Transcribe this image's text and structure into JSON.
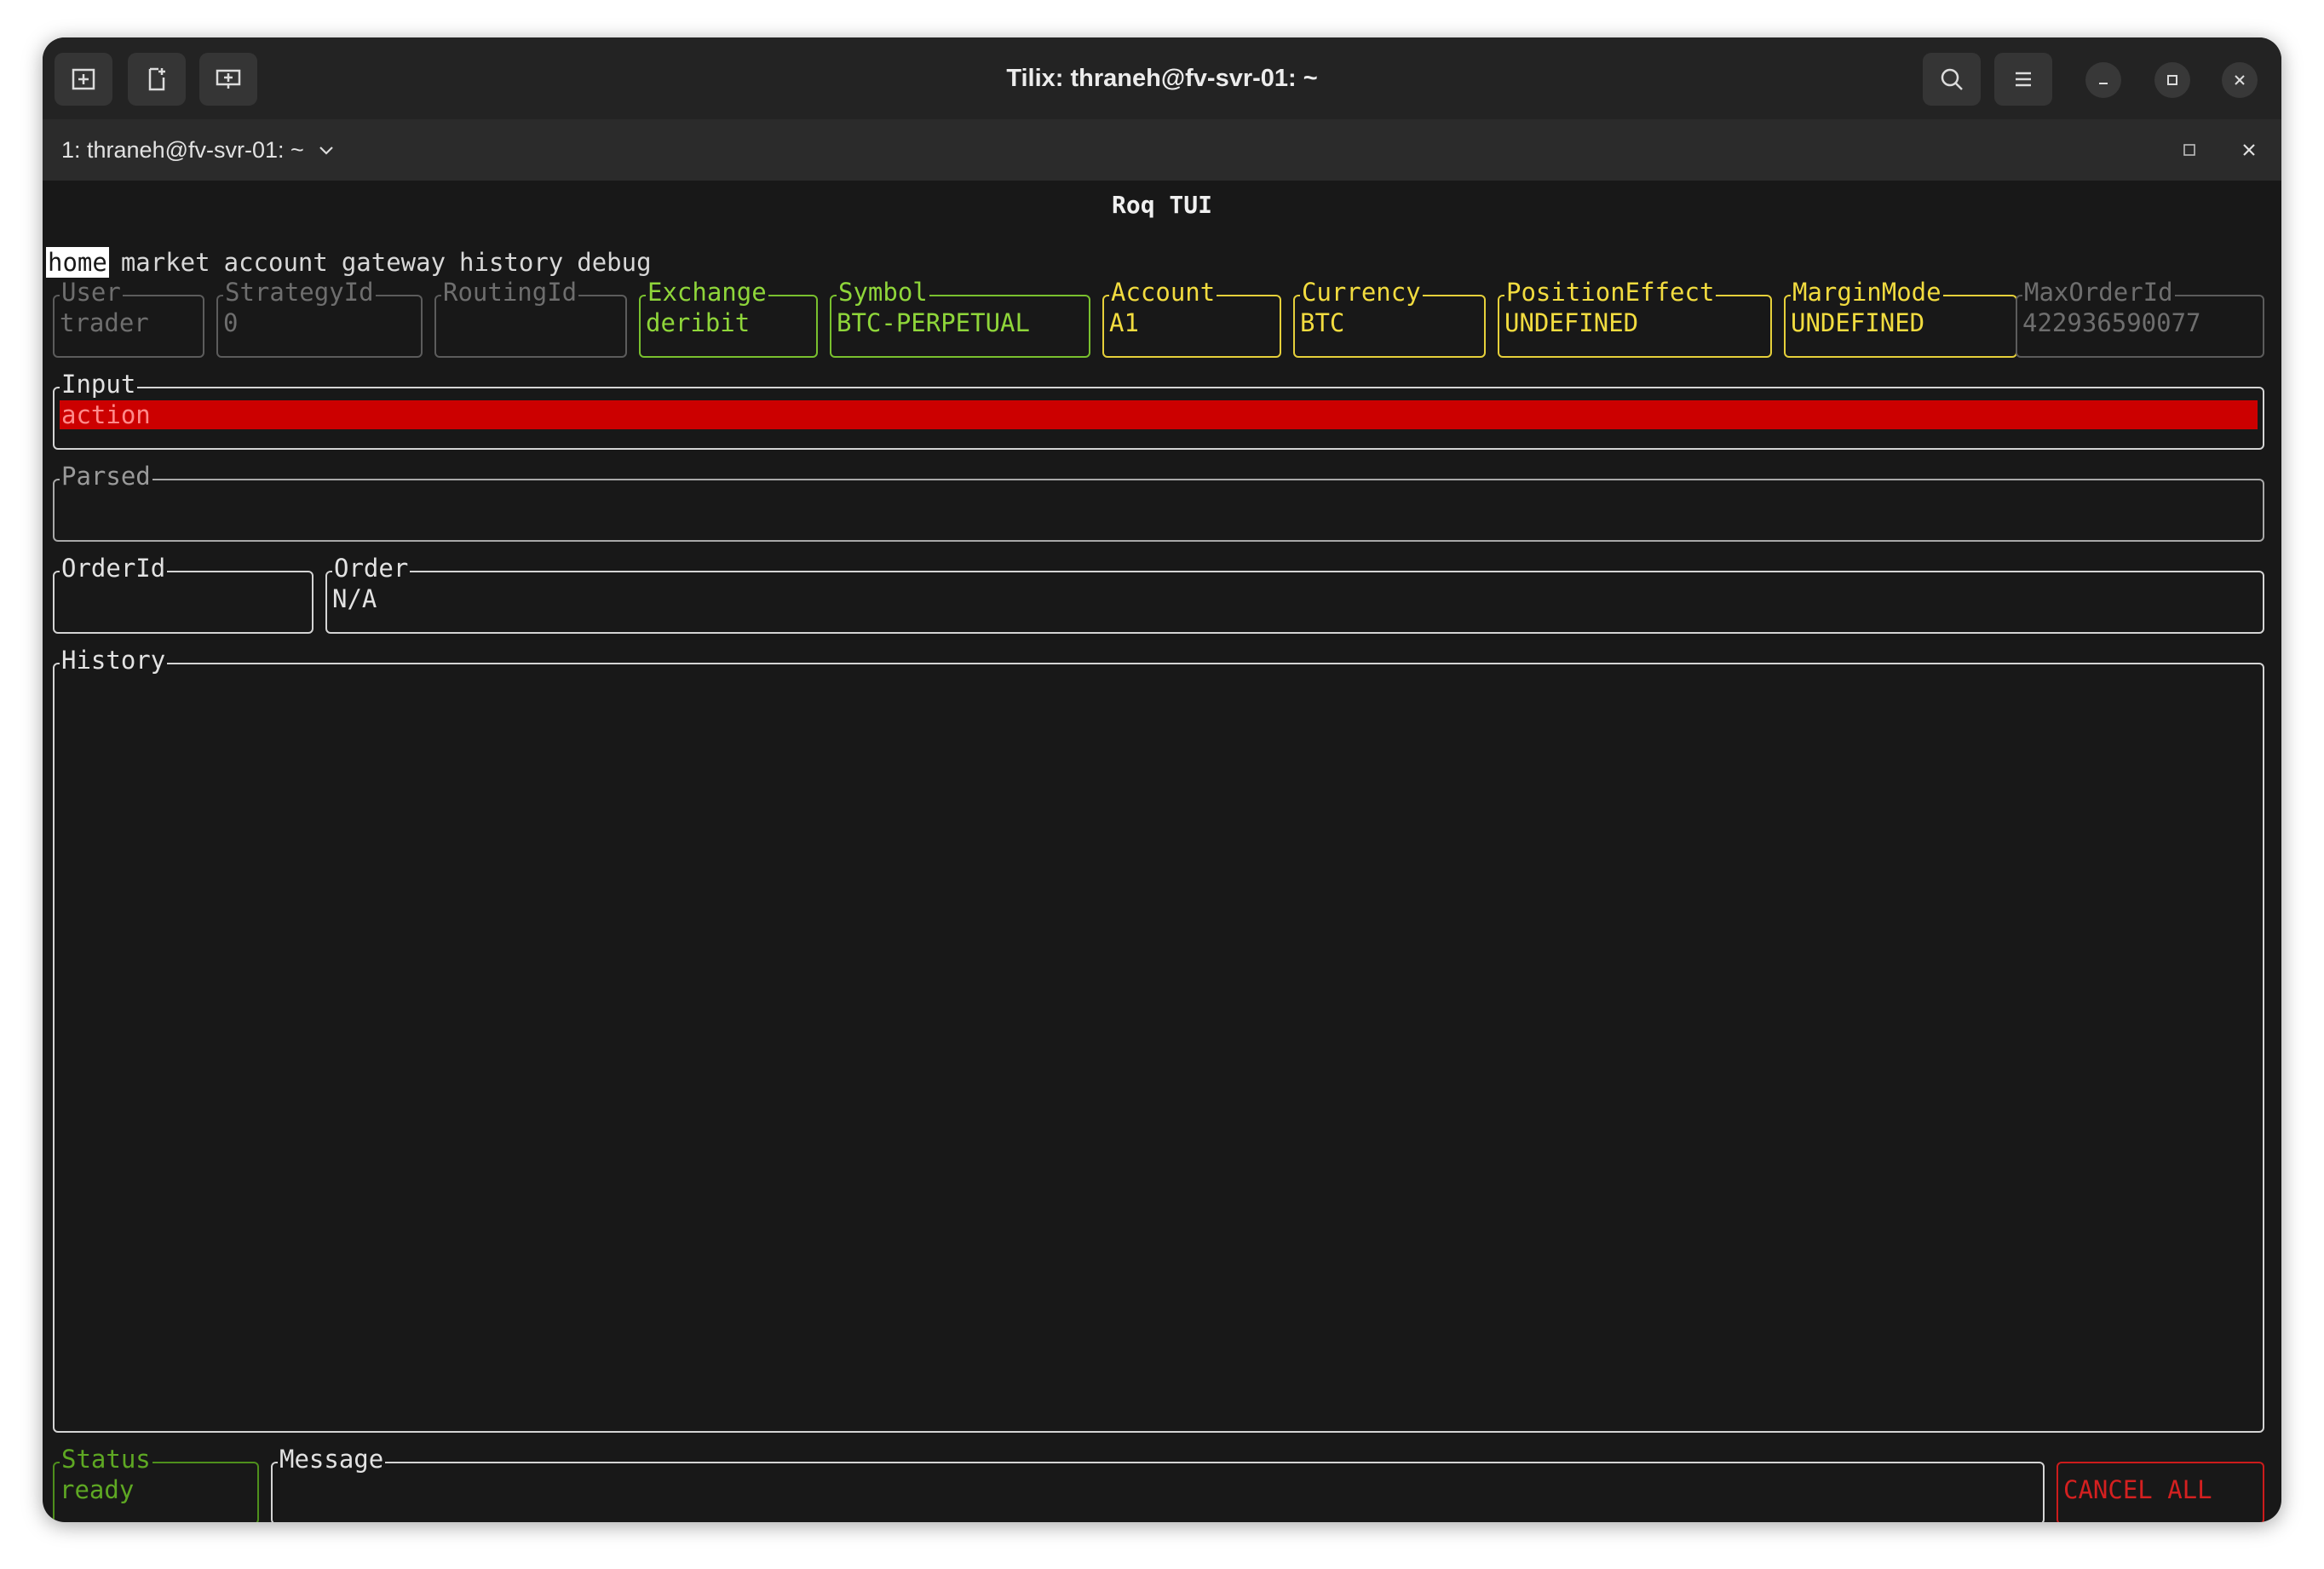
{
  "window": {
    "title": "Tilix: thraneh@fv-svr-01: ~",
    "tab_label": "1: thraneh@fv-svr-01: ~"
  },
  "app": {
    "title": "Roq TUI",
    "menu": [
      "home",
      "market",
      "account",
      "gateway",
      "history",
      "debug"
    ],
    "active_menu": "home"
  },
  "fields": {
    "user": {
      "label": "User",
      "value": "trader"
    },
    "strategy_id": {
      "label": "StrategyId",
      "value": "0"
    },
    "routing_id": {
      "label": "RoutingId",
      "value": ""
    },
    "exchange": {
      "label": "Exchange",
      "value": "deribit"
    },
    "symbol": {
      "label": "Symbol",
      "value": "BTC-PERPETUAL"
    },
    "account": {
      "label": "Account",
      "value": "A1"
    },
    "currency": {
      "label": "Currency",
      "value": "BTC"
    },
    "position_effect": {
      "label": "PositionEffect",
      "value": "UNDEFINED"
    },
    "margin_mode": {
      "label": "MarginMode",
      "value": "UNDEFINED"
    },
    "max_order_id": {
      "label": "MaxOrderId",
      "value": "422936590077"
    }
  },
  "input": {
    "label": "Input",
    "value": "action"
  },
  "parsed": {
    "label": "Parsed",
    "value": ""
  },
  "order_id": {
    "label": "OrderId",
    "value": ""
  },
  "order": {
    "label": "Order",
    "value": "N/A"
  },
  "history": {
    "label": "History"
  },
  "status": {
    "label": "Status",
    "value": "ready"
  },
  "message": {
    "label": "Message",
    "value": ""
  },
  "cancel_all": {
    "label": "CANCEL ALL"
  },
  "colors": {
    "green": "#8fd63a",
    "yellow": "#f2dc3f",
    "red": "#cc0000",
    "gray": "#6e6e6e"
  }
}
